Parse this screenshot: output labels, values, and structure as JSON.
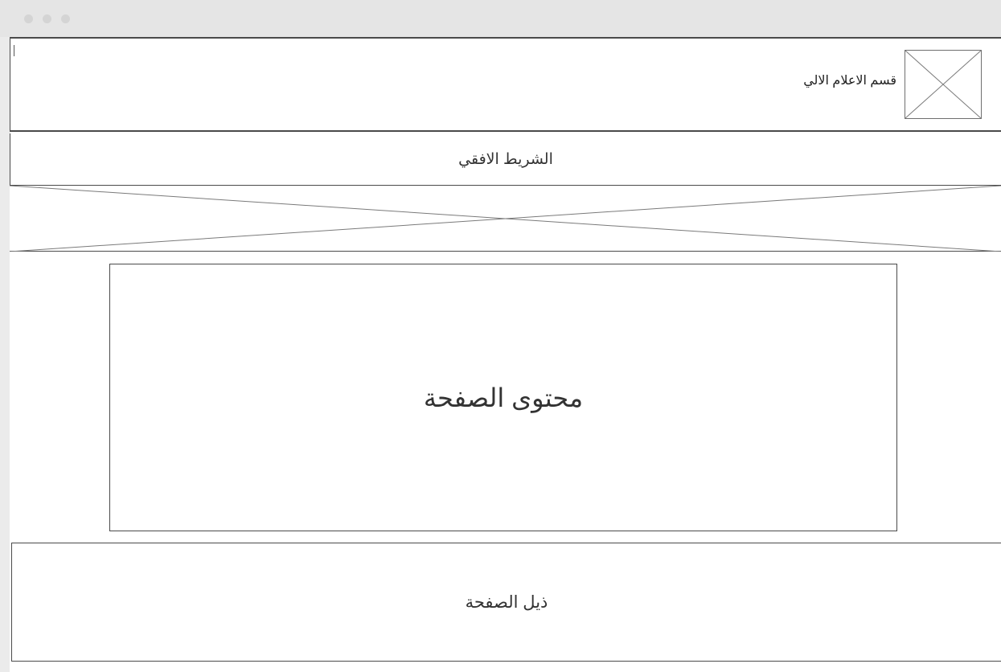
{
  "header": {
    "title": "قسم الاعلام الالي",
    "logo_icon": "image-placeholder-icon"
  },
  "navbar": {
    "label": "الشريط الافقي"
  },
  "banner": {
    "icon": "image-placeholder-icon"
  },
  "main": {
    "label": "محتوى الصفحة"
  },
  "footer": {
    "label": "ذيل الصفحة"
  },
  "colors": {
    "border": "#4a4a4a",
    "placeholder_line": "#7a7a7a",
    "window_chrome": "#e5e5e5"
  }
}
